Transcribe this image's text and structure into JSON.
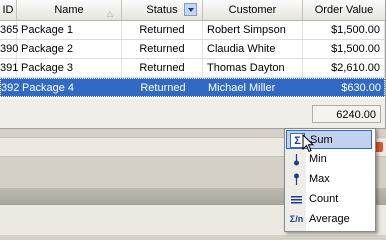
{
  "grid": {
    "columns": [
      "ID",
      "Name",
      "Status",
      "Customer",
      "Order Value"
    ],
    "rows": [
      {
        "id": "365",
        "name": "Package 1",
        "status": "Returned",
        "customer": "Robert Simpson",
        "value": "$1,500.00"
      },
      {
        "id": "390",
        "name": "Package 2",
        "status": "Returned",
        "customer": "Claudia White",
        "value": "$1,500.00"
      },
      {
        "id": "391",
        "name": "Package 3",
        "status": "Returned",
        "customer": "Thomas Dayton",
        "value": "$2,610.00"
      },
      {
        "id": "392",
        "name": "Package 4",
        "status": "Returned",
        "customer": "Michael Miller",
        "value": "$630.00"
      }
    ],
    "selected_row": 3,
    "footer_total": "6240.00"
  },
  "summary_menu": {
    "items": [
      {
        "label": "Sum",
        "icon": "sigma-icon"
      },
      {
        "label": "Min",
        "icon": "min-icon"
      },
      {
        "label": "Max",
        "icon": "max-icon"
      },
      {
        "label": "Count",
        "icon": "count-icon"
      },
      {
        "label": "Average",
        "icon": "average-icon"
      }
    ],
    "highlighted": "Sum"
  },
  "colors": {
    "selection": "#316ac5",
    "menu_highlight": "#c1d2ee",
    "panel_close": "#e0562c"
  }
}
